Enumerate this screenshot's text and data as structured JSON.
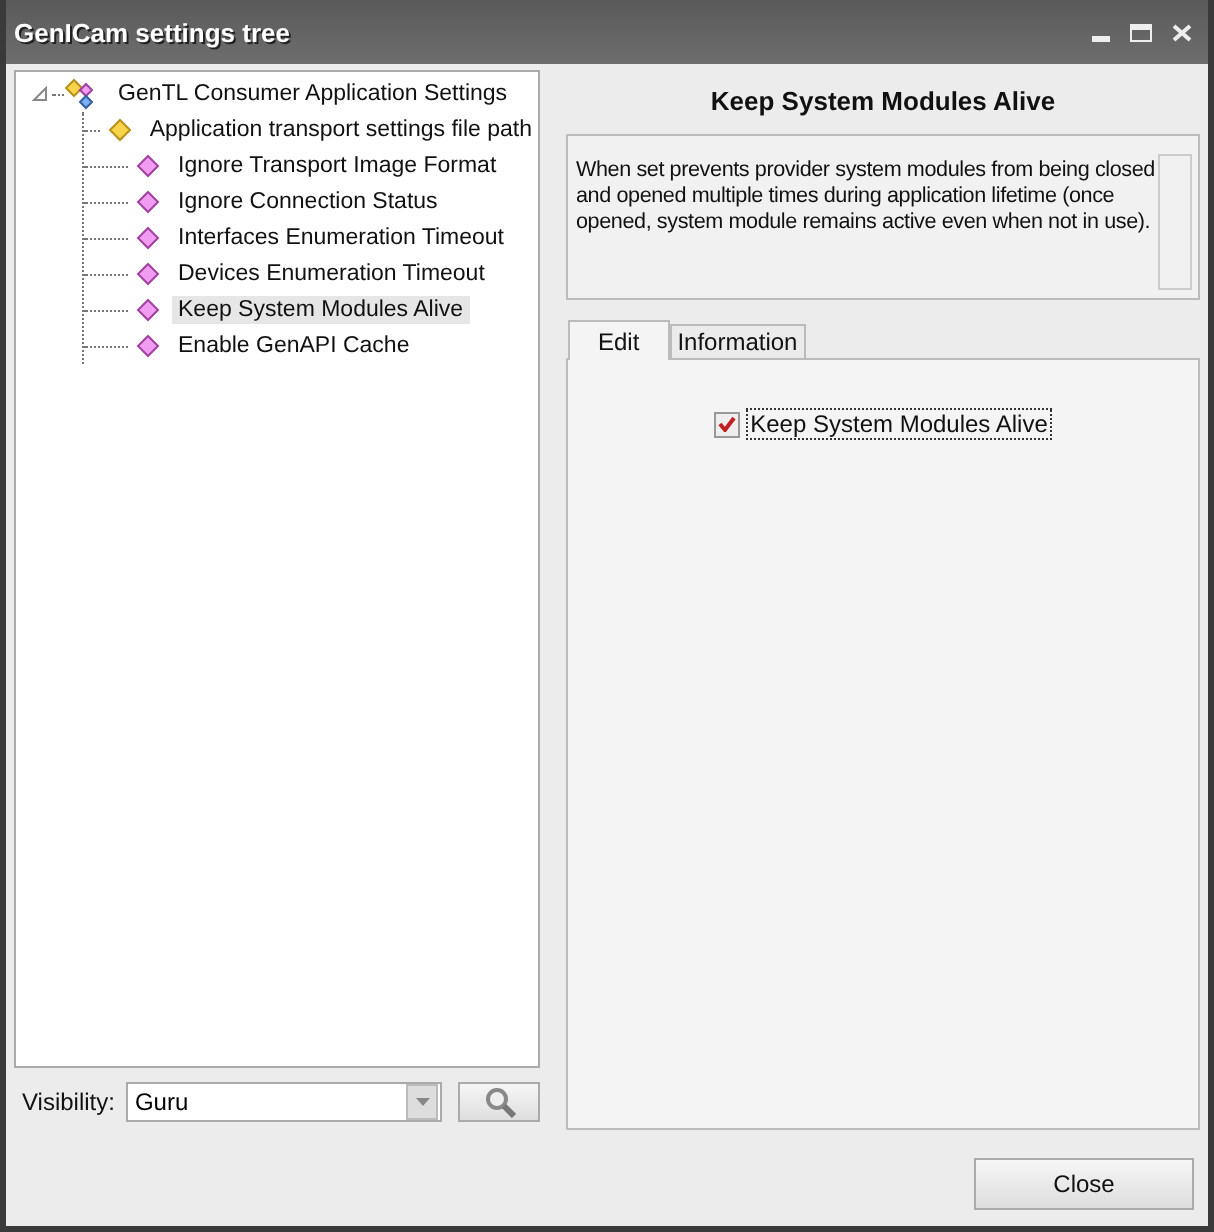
{
  "window": {
    "title": "GenICam settings tree"
  },
  "tree": {
    "label": "GenTL Consumer Application Settings",
    "expanded": true,
    "selected": false,
    "children": [
      {
        "label": "Application transport settings file path",
        "kind": "string",
        "selected": false
      },
      {
        "label": "Ignore Transport Image Format",
        "kind": "boolean",
        "selected": false
      },
      {
        "label": "Ignore Connection Status",
        "kind": "boolean",
        "selected": false
      },
      {
        "label": "Interfaces Enumeration Timeout",
        "kind": "boolean",
        "selected": false
      },
      {
        "label": "Devices Enumeration Timeout",
        "kind": "boolean",
        "selected": false
      },
      {
        "label": "Keep System Modules Alive",
        "kind": "boolean",
        "selected": true
      },
      {
        "label": "Enable GenAPI Cache",
        "kind": "boolean",
        "selected": false
      }
    ]
  },
  "visibility": {
    "label": "Visibility:",
    "value": "Guru"
  },
  "detail": {
    "title": "Keep System Modules Alive",
    "description": "When set prevents provider system modules from being closed and opened multiple times during application lifetime (once opened, system module remains active even when not in use).",
    "tabs": [
      {
        "label": "Edit",
        "selected": true
      },
      {
        "label": "Information",
        "selected": false
      }
    ],
    "checkbox": {
      "label": "Keep System Modules Alive",
      "checked": true
    }
  },
  "buttons": [
    "Close"
  ]
}
